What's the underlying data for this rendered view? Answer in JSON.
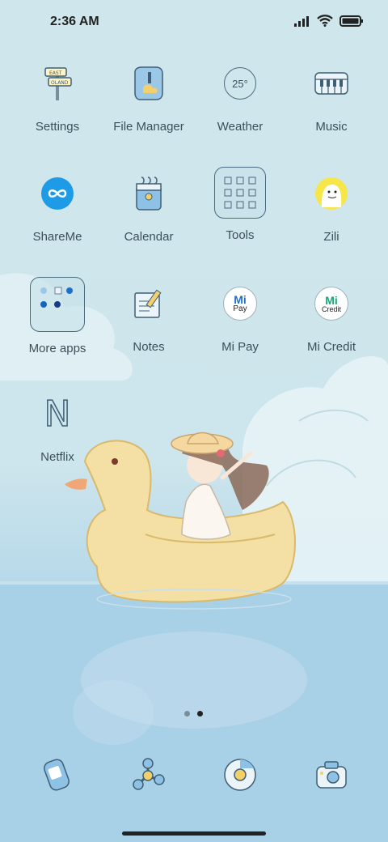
{
  "status_bar": {
    "time": "2:36 AM",
    "battery_icon": "battery-icon",
    "wifi_icon": "wifi-icon",
    "signal_icon": "signal-icon"
  },
  "apps": {
    "settings": {
      "label": "Settings",
      "icon": "signpost-icon"
    },
    "file_manager": {
      "label": "File Manager",
      "icon": "folder-pen-icon"
    },
    "weather": {
      "label": "Weather",
      "icon": "weather-icon",
      "temp": "25°"
    },
    "music": {
      "label": "Music",
      "icon": "piano-icon"
    },
    "shareme": {
      "label": "ShareMe",
      "icon": "infinity-icon"
    },
    "calendar": {
      "label": "Calendar",
      "icon": "calendar-icon"
    },
    "tools": {
      "label": "Tools",
      "icon": "folder-icon"
    },
    "zili": {
      "label": "Zili",
      "icon": "zili-face-icon"
    },
    "more_apps": {
      "label": "More apps",
      "icon": "folder-icon"
    },
    "notes": {
      "label": "Notes",
      "icon": "notes-icon"
    },
    "mi_pay": {
      "label": "Mi Pay",
      "icon": "mi-pay-icon",
      "badge": "Pay"
    },
    "mi_credit": {
      "label": "Mi Credit",
      "icon": "mi-credit-icon",
      "badge": "Credit"
    },
    "netflix": {
      "label": "Netflix",
      "icon": "netflix-icon",
      "letter": "N"
    }
  },
  "page_indicator": {
    "pages": 2,
    "active": 2
  },
  "dock": [
    {
      "name": "phone",
      "icon": "phone-icon"
    },
    {
      "name": "messages",
      "icon": "messages-icon"
    },
    {
      "name": "browser",
      "icon": "chrome-icon"
    },
    {
      "name": "camera",
      "icon": "camera-icon"
    }
  ],
  "colors": {
    "sky": "#cde5ec",
    "water": "#a9d0e6",
    "label": "#3d4f5a",
    "accent_blue": "#1e9be6",
    "line": "#4b6a80"
  }
}
